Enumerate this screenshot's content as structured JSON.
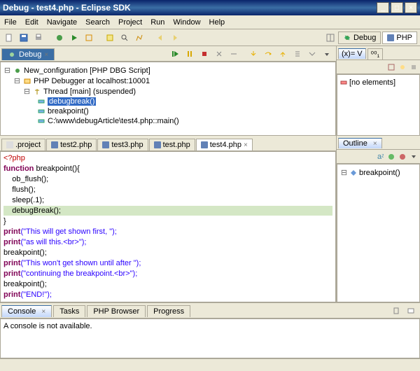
{
  "title": "Debug - test4.php - Eclipse SDK",
  "menu": [
    "File",
    "Edit",
    "Navigate",
    "Search",
    "Project",
    "Run",
    "Window",
    "Help"
  ],
  "perspectives": {
    "debug": "Debug",
    "php": "PHP"
  },
  "debug_view": {
    "tab": "Debug",
    "tree": {
      "root": "New_configuration [PHP DBG Script]",
      "debugger": "PHP Debugger at localhost:10001",
      "thread": "Thread [main] (suspended)",
      "f0": "debugbreak()",
      "f1": "breakpoint()",
      "f2": "C:\\www\\debugArticle\\test4.php::main()"
    }
  },
  "vars_view": {
    "tab_v": "(x)= V",
    "tab_b": "⁰⁰₁",
    "empty": "[no elements]"
  },
  "editor_tabs": [
    ".project",
    "test2.php",
    "test3.php",
    "test.php",
    "test4.php"
  ],
  "active_tab_index": 4,
  "code": {
    "l0": "<?php",
    "l1_kw": "function",
    "l1_rest": " breakpoint(){",
    "l2": "    ob_flush();",
    "l3": "    flush();",
    "l4": "    sleep(.1);",
    "l5": "    debugBreak();",
    "l6": "}",
    "l7a": "print",
    "l7b": "(\"This will get shown first, \");",
    "l8a": "print",
    "l8b": "(\"as will this.<br>\");",
    "l9": "breakpoint();",
    "l10a": "print",
    "l10b": "(\"This won't get shown until after \");",
    "l11a": "print",
    "l11b": "(\"continuing the breakpoint.<br>\");",
    "l12": "breakpoint();",
    "l13a": "print",
    "l13b": "(\"END!\");",
    "l14": "?>"
  },
  "outline": {
    "tab": "Outline",
    "item": "breakpoint()"
  },
  "console": {
    "tabs": [
      "Console",
      "Tasks",
      "PHP Browser",
      "Progress"
    ],
    "msg": "A console is not available."
  }
}
